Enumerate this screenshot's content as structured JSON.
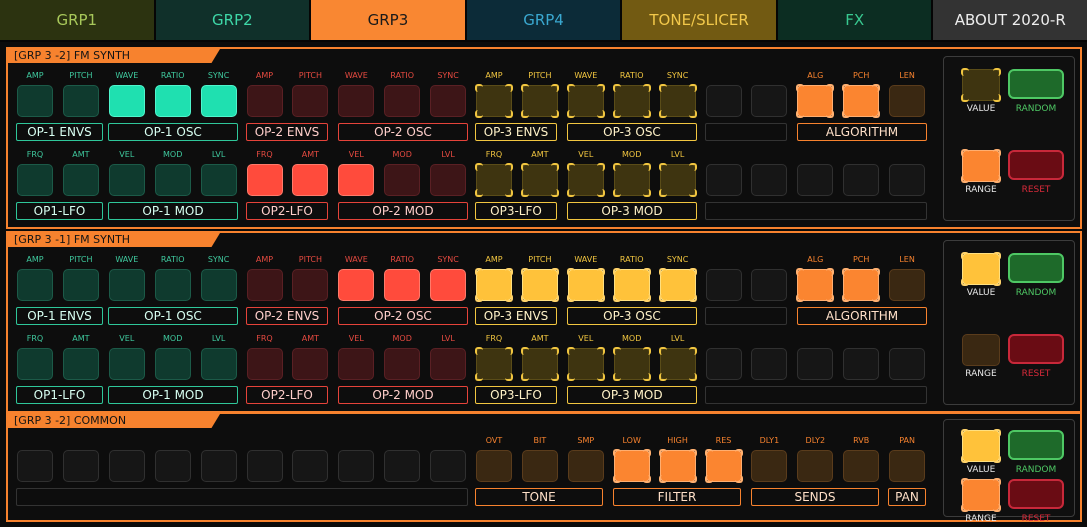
{
  "tabs": [
    {
      "label": "GRP1",
      "bg": "#2c3310",
      "fg": "#a8c85a"
    },
    {
      "label": "GRP2",
      "bg": "#10302a",
      "fg": "#3ed8a8"
    },
    {
      "label": "GRP3",
      "bg": "#f98732",
      "fg": "#1a1a1a",
      "selected": true
    },
    {
      "label": "GRP4",
      "bg": "#0c2b38",
      "fg": "#3aa8d0"
    },
    {
      "label": "TONE/SLICER",
      "bg": "#725a12",
      "fg": "#f2c84a"
    },
    {
      "label": "FX",
      "bg": "#0c2d22",
      "fg": "#38c890"
    },
    {
      "label": "ABOUT 2020-R",
      "bg": "#333333",
      "fg": "#eeeeee"
    }
  ],
  "panels": [
    {
      "title": "[GRP 3 -2] FM SYNTH",
      "row1_labels": [
        "AMP",
        "PITCH",
        "WAVE",
        "RATIO",
        "SYNC",
        "AMP",
        "PITCH",
        "WAVE",
        "RATIO",
        "SYNC",
        "AMP",
        "PITCH",
        "WAVE",
        "RATIO",
        "SYNC",
        "",
        "",
        "ALG",
        "PCH",
        "LEN"
      ],
      "row1_pads": [
        "tD",
        "tD",
        "tB",
        "tB",
        "tB",
        "rD",
        "rD",
        "rD",
        "rD",
        "rD",
        "yD",
        "yD",
        "yD",
        "yD",
        "yD",
        "n",
        "n",
        "oB",
        "oB",
        "bD"
      ],
      "row1_groups": [
        "OP-1 ENVS",
        "OP-1 OSC",
        "OP-2 ENVS",
        "OP-2 OSC",
        "OP-3 ENVS",
        "OP-3 OSC",
        "",
        "ALGORITHM"
      ],
      "row2_labels": [
        "FRQ",
        "AMT",
        "VEL",
        "MOD",
        "LVL",
        "FRQ",
        "AMT",
        "VEL",
        "MOD",
        "LVL",
        "FRQ",
        "AMT",
        "VEL",
        "MOD",
        "LVL",
        "",
        "",
        "",
        "",
        ""
      ],
      "row2_pads": [
        "tD",
        "tD",
        "tD",
        "tD",
        "tD",
        "rB",
        "rB",
        "rB",
        "rD",
        "rD",
        "yD",
        "yD",
        "yD",
        "yD",
        "yD",
        "n",
        "n",
        "n",
        "n",
        "n"
      ],
      "row2_groups": [
        "OP1-LFO",
        "OP-1 MOD",
        "OP2-LFO",
        "OP-2 MOD",
        "OP3-LFO",
        "OP-3 MOD",
        ""
      ],
      "ctrl": {
        "value_label": "VALUE",
        "random_label": "RANDOM",
        "range_label": "RANGE",
        "reset_label": "RESET",
        "value_state": "yD",
        "range_state": "oB"
      }
    },
    {
      "title": "[GRP 3 -1] FM SYNTH",
      "row1_labels": [
        "AMP",
        "PITCH",
        "WAVE",
        "RATIO",
        "SYNC",
        "AMP",
        "PITCH",
        "WAVE",
        "RATIO",
        "SYNC",
        "AMP",
        "PITCH",
        "WAVE",
        "RATIO",
        "SYNC",
        "",
        "",
        "ALG",
        "PCH",
        "LEN"
      ],
      "row1_pads": [
        "tD",
        "tD",
        "tD",
        "tD",
        "tD",
        "rD",
        "rD",
        "rB",
        "rB",
        "rB",
        "yB",
        "yB",
        "yB",
        "yB",
        "yB",
        "n",
        "n",
        "oB",
        "oB",
        "bD"
      ],
      "row1_groups": [
        "OP-1 ENVS",
        "OP-1 OSC",
        "OP-2 ENVS",
        "OP-2 OSC",
        "OP-3 ENVS",
        "OP-3 OSC",
        "",
        "ALGORITHM"
      ],
      "row2_labels": [
        "FRQ",
        "AMT",
        "VEL",
        "MOD",
        "LVL",
        "FRQ",
        "AMT",
        "VEL",
        "MOD",
        "LVL",
        "FRQ",
        "AMT",
        "VEL",
        "MOD",
        "LVL",
        "",
        "",
        "",
        "",
        ""
      ],
      "row2_pads": [
        "tD",
        "tD",
        "tD",
        "tD",
        "tD",
        "rD",
        "rD",
        "rD",
        "rD",
        "rD",
        "yD",
        "yD",
        "yD",
        "yD",
        "yD",
        "n",
        "n",
        "n",
        "n",
        "n"
      ],
      "row2_groups": [
        "OP1-LFO",
        "OP-1 MOD",
        "OP2-LFO",
        "OP-2 MOD",
        "OP3-LFO",
        "OP-3 MOD",
        ""
      ],
      "ctrl": {
        "value_label": "VALUE",
        "random_label": "RANDOM",
        "range_label": "RANGE",
        "reset_label": "RESET",
        "value_state": "yB",
        "range_state": "bD"
      }
    }
  ],
  "common": {
    "title": "[GRP 3 -2] COMMON",
    "labels": [
      "",
      "",
      "",
      "",
      "",
      "",
      "",
      "",
      "",
      "",
      "OVT",
      "BIT",
      "SMP",
      "LOW",
      "HIGH",
      "RES",
      "DLY1",
      "DLY2",
      "RVB",
      "PAN"
    ],
    "pads": [
      "n",
      "n",
      "n",
      "n",
      "n",
      "n",
      "n",
      "n",
      "n",
      "n",
      "bD",
      "bD",
      "bD",
      "oB",
      "oB",
      "oB",
      "bD",
      "bD",
      "bD",
      "bD"
    ],
    "groups": [
      "",
      "TONE",
      "FILTER",
      "SENDS",
      "PAN"
    ],
    "ctrl": {
      "value_label": "VALUE",
      "random_label": "RANDOM",
      "range_label": "RANGE",
      "reset_label": "RESET",
      "value_state": "yB",
      "range_state": "oB"
    }
  },
  "colors": {
    "accent": "#f7822e",
    "teal_group": "#2fc79a",
    "red_group": "#e5433a",
    "yellow_group": "#f2c640",
    "orange_group": "#f7822e",
    "gray_group": "#333333",
    "random_green": "#1e6a2a",
    "reset_red": "#6a0c14"
  }
}
